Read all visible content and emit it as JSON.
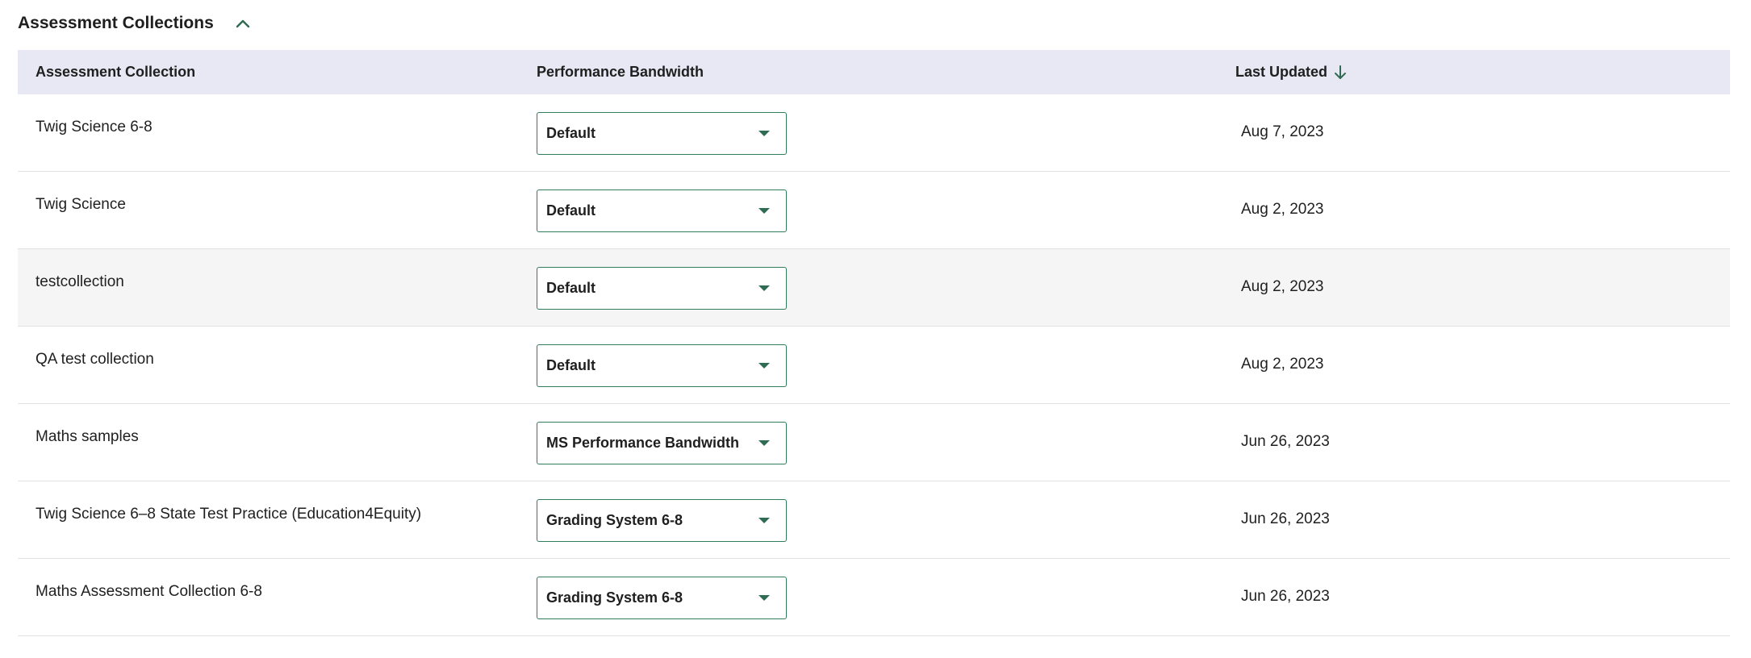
{
  "section": {
    "title": "Assessment Collections",
    "toggle_icon": "chevron-up-icon"
  },
  "table": {
    "headers": {
      "collection": "Assessment Collection",
      "bandwidth": "Performance Bandwidth",
      "updated": "Last Updated",
      "sort_icon": "arrow-down-icon"
    },
    "rows": [
      {
        "name": "Twig Science 6-8",
        "bandwidth": "Default",
        "updated": "Aug 7, 2023"
      },
      {
        "name": "Twig Science",
        "bandwidth": "Default",
        "updated": "Aug 2, 2023"
      },
      {
        "name": "testcollection",
        "bandwidth": "Default",
        "updated": "Aug 2, 2023"
      },
      {
        "name": "QA test collection",
        "bandwidth": "Default",
        "updated": "Aug 2, 2023"
      },
      {
        "name": "Maths samples",
        "bandwidth": "MS Performance Bandwidth",
        "updated": "Jun 26, 2023"
      },
      {
        "name": "Twig Science 6–8 State Test Practice (Education4Equity)",
        "bandwidth": "Grading System 6-8",
        "updated": "Jun 26, 2023"
      },
      {
        "name": "Maths Assessment Collection 6-8",
        "bandwidth": "Grading System 6-8",
        "updated": "Jun 26, 2023"
      }
    ]
  },
  "colors": {
    "header_bg": "#e8e8f4",
    "accent": "#2e7d5b",
    "hover_row_bg": "#f5f5f5"
  }
}
